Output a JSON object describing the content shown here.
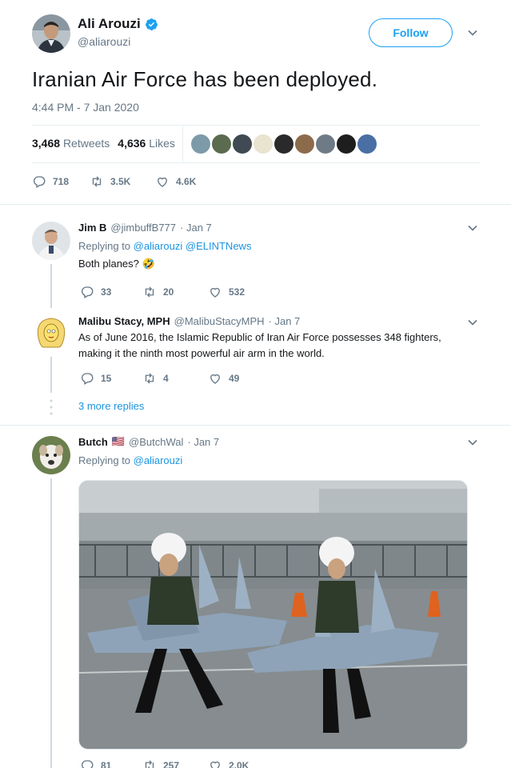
{
  "main": {
    "author_name": "Ali Arouzi",
    "handle": "@aliarouzi",
    "follow_label": "Follow",
    "text": "Iranian Air Force has been deployed.",
    "timestamp": "4:44 PM - 7 Jan 2020",
    "retweets_count": "3,468",
    "retweets_label": "Retweets",
    "likes_count": "4,636",
    "likes_label": "Likes",
    "reply_count": "718",
    "retweet_count_short": "3.5K",
    "like_count_short": "4.6K"
  },
  "replies": [
    {
      "name": "Jim B",
      "handle": "@jimbuffB777",
      "date": "· Jan 7",
      "replying_prefix": "Replying to",
      "replying_to": "@aliarouzi @ELINTNews",
      "text": "Both planes? 🤣",
      "replies": "33",
      "retweets": "20",
      "likes": "532"
    },
    {
      "name": "Malibu Stacy, MPH",
      "handle": "@MalibuStacyMPH",
      "date": "· Jan 7",
      "text": "As of June 2016, the Islamic Republic of Iran Air Force possesses 348 fighters, making it the ninth most powerful air arm in the world.",
      "replies": "15",
      "retweets": "4",
      "likes": "49"
    },
    {
      "name": "Butch",
      "flag": "🇺🇸",
      "handle": "@ButchWal",
      "date": "· Jan 7",
      "replying_prefix": "Replying to",
      "replying_to": "@aliarouzi",
      "replies": "81",
      "retweets": "257",
      "likes": "2.0K"
    }
  ],
  "more_replies": "3 more replies",
  "colors": {
    "accent": "#1da1f2",
    "link": "#1b95e0",
    "muted": "#657786",
    "divider": "#e6ecf0"
  },
  "icons": [
    "verified-badge-icon",
    "chevron-down-icon",
    "reply-icon",
    "retweet-icon",
    "like-icon"
  ]
}
